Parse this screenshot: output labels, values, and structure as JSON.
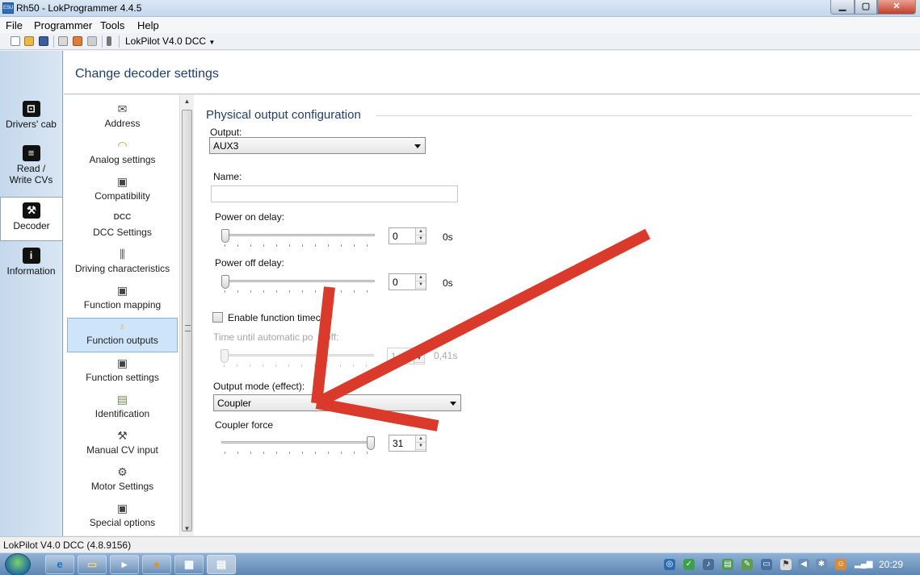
{
  "window": {
    "title": "Rh50 - LokProgrammer 4.4.5",
    "minimize": "▁",
    "maximize": "▢",
    "close": "✕"
  },
  "menu": [
    "File",
    "Programmer",
    "Tools",
    "Help"
  ],
  "toolbar": {
    "decoder_select": "LokPilot V4.0 DCC"
  },
  "leftnav": [
    {
      "label_line1": "Drivers' cab",
      "label_line2": "",
      "icon": "cab-icon"
    },
    {
      "label_line1": "Read /",
      "label_line2": "Write CVs",
      "icon": "cv-icon"
    },
    {
      "label_line1": "Decoder",
      "label_line2": "",
      "icon": "wrench-icon"
    },
    {
      "label_line1": "Information",
      "label_line2": "",
      "icon": "info-icon"
    }
  ],
  "header": {
    "title": "Change decoder settings"
  },
  "subnav": [
    "Address",
    "Analog settings",
    "Compatibility",
    "DCC Settings",
    "Driving characteristics",
    "Function mapping",
    "Function outputs",
    "Function settings",
    "Identification",
    "Manual CV input",
    "Motor Settings",
    "Special options"
  ],
  "main": {
    "section_title": "Physical output configuration",
    "output_label": "Output:",
    "output_value": "AUX3",
    "name_label": "Name:",
    "name_value": "",
    "power_on_label": "Power on delay:",
    "power_on_value": "0",
    "power_on_unit": "0s",
    "power_off_label": "Power off delay:",
    "power_off_value": "0",
    "power_off_unit": "0s",
    "enable_timeout_label": "Enable function timec",
    "auto_off_label": "Time until automatic po",
    "auto_off_label_tail": "r off:",
    "auto_off_value": "1",
    "auto_off_unit": "0,41s",
    "mode_label": "Output mode (effect):",
    "mode_value": "Coupler",
    "coupler_force_label": "Coupler force",
    "coupler_force_value": "31",
    "power_on_level": 0,
    "power_off_level": 0,
    "auto_off_level": 0,
    "coupler_force_level": 1
  },
  "statusbar": {
    "text": "LokPilot V4.0 DCC (4.8.9156)"
  },
  "taskbar": {
    "clock": "20:29"
  },
  "colors": {
    "annotation_arrow": "#d93a2b",
    "accent": "#1f3f6a",
    "selection": "#cde4fa"
  }
}
